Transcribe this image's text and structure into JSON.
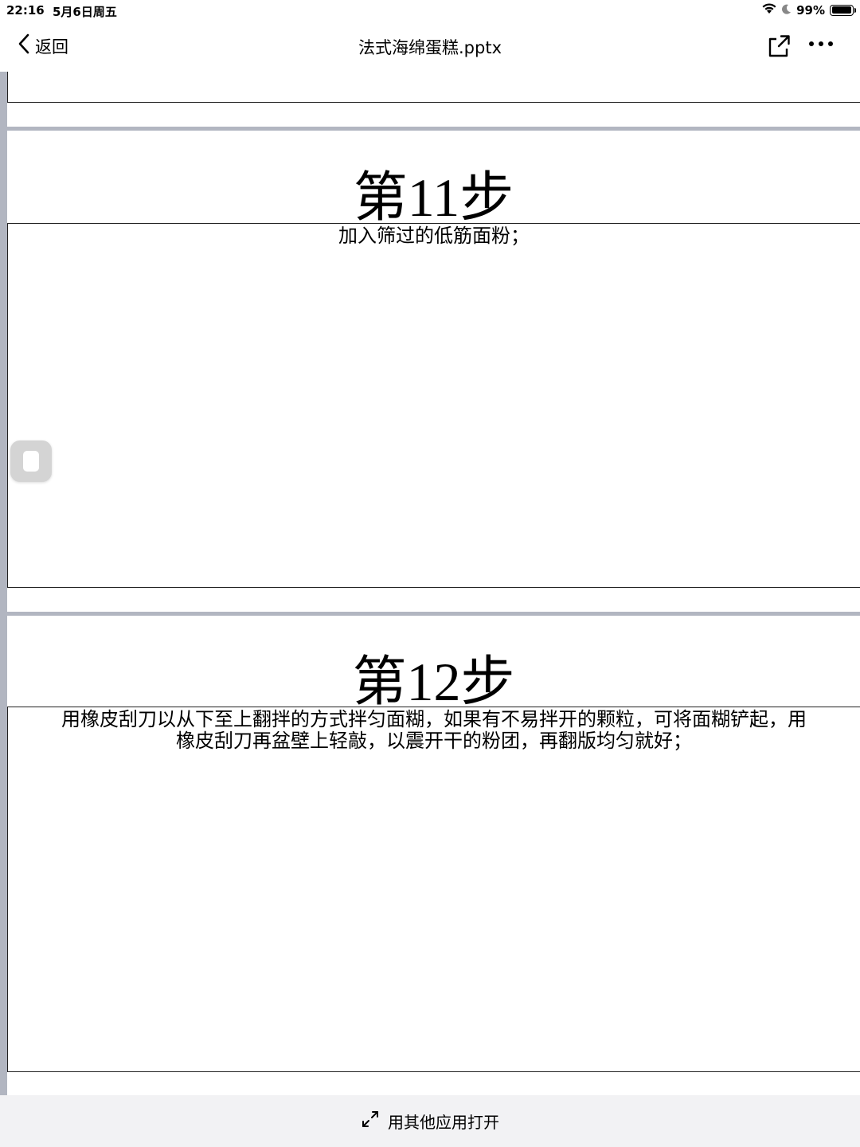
{
  "status_bar": {
    "time": "22:16",
    "date": "5月6日周五",
    "battery": "99%",
    "battery_level": 0.99
  },
  "nav": {
    "back_label": "返回",
    "title": "法式海绵蛋糕.pptx",
    "icons": [
      "chevron-left-icon",
      "share-icon",
      "more-icon"
    ]
  },
  "slides": [
    {
      "title": "第11步",
      "body": "加入筛过的低筋面粉；"
    },
    {
      "title": "第12步",
      "body_line1": "用橡皮刮刀以从下至上翻拌的方式拌匀面糊，如果有不易拌开的颗粒，可将面糊铲起，用",
      "body_line2": "橡皮刮刀再盆壁上轻敲，以震开干的粉团，再翻版均匀就好；"
    }
  ],
  "bottom_bar": {
    "open_with_label": "用其他应用打开",
    "icon": "expand-icon"
  },
  "colors": {
    "separator": "#b2b6c1",
    "bottom_bar_bg": "#f2f2f4"
  }
}
